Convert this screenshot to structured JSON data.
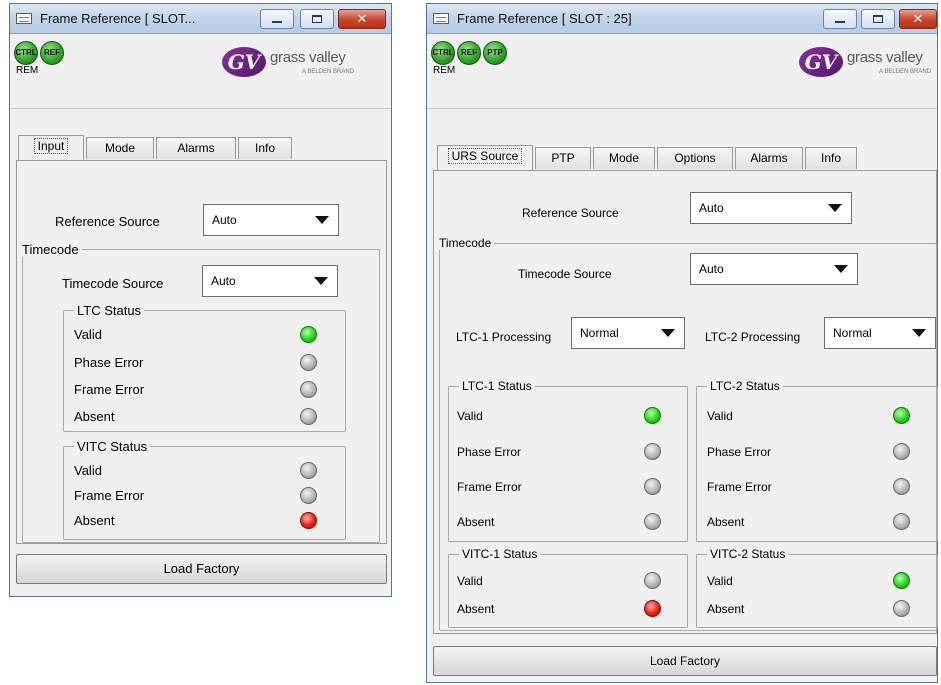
{
  "left_window": {
    "title": "Frame Reference [ SLOT...",
    "badges": [
      "CTRL",
      "REF"
    ],
    "rem_label": "REM",
    "logo": {
      "name": "grass valley",
      "sub": "A BELDEN BRAND"
    },
    "tabs": [
      "Input",
      "Mode",
      "Alarms",
      "Info"
    ],
    "active_tab": "Input",
    "reference_source": {
      "label": "Reference Source",
      "value": "Auto"
    },
    "timecode": {
      "group_label": "Timecode",
      "source_label": "Timecode Source",
      "source_value": "Auto",
      "ltc_status": {
        "title": "LTC Status",
        "rows": [
          {
            "label": "Valid",
            "state": "green"
          },
          {
            "label": "Phase Error",
            "state": "grey"
          },
          {
            "label": "Frame Error",
            "state": "grey"
          },
          {
            "label": "Absent",
            "state": "grey"
          }
        ]
      },
      "vitc_status": {
        "title": "VITC Status",
        "rows": [
          {
            "label": "Valid",
            "state": "grey"
          },
          {
            "label": "Frame Error",
            "state": "grey"
          },
          {
            "label": "Absent",
            "state": "red"
          }
        ]
      }
    },
    "load_factory": "Load Factory"
  },
  "right_window": {
    "title": "Frame Reference [ SLOT : 25]",
    "badges": [
      "CTRL",
      "REF",
      "PTP"
    ],
    "rem_label": "REM",
    "logo": {
      "name": "grass valley",
      "sub": "A BELDEN BRAND"
    },
    "tabs": [
      "URS Source",
      "PTP",
      "Mode",
      "Options",
      "Alarms",
      "Info"
    ],
    "active_tab": "URS Source",
    "reference_source": {
      "label": "Reference Source",
      "value": "Auto"
    },
    "timecode": {
      "group_label": "Timecode",
      "source_label": "Timecode Source",
      "source_value": "Auto",
      "ltc1_processing": {
        "label": "LTC-1 Processing",
        "value": "Normal"
      },
      "ltc2_processing": {
        "label": "LTC-2 Processing",
        "value": "Normal"
      },
      "ltc1_status": {
        "title": "LTC-1 Status",
        "rows": [
          {
            "label": "Valid",
            "state": "green"
          },
          {
            "label": "Phase Error",
            "state": "grey"
          },
          {
            "label": "Frame Error",
            "state": "grey"
          },
          {
            "label": "Absent",
            "state": "grey"
          }
        ]
      },
      "ltc2_status": {
        "title": "LTC-2 Status",
        "rows": [
          {
            "label": "Valid",
            "state": "green"
          },
          {
            "label": "Phase Error",
            "state": "grey"
          },
          {
            "label": "Frame Error",
            "state": "grey"
          },
          {
            "label": "Absent",
            "state": "grey"
          }
        ]
      },
      "vitc1_status": {
        "title": "VITC-1 Status",
        "rows": [
          {
            "label": "Valid",
            "state": "grey"
          },
          {
            "label": "Absent",
            "state": "red"
          }
        ]
      },
      "vitc2_status": {
        "title": "VITC-2 Status",
        "rows": [
          {
            "label": "Valid",
            "state": "green"
          },
          {
            "label": "Absent",
            "state": "grey"
          }
        ]
      }
    },
    "load_factory": "Load Factory"
  }
}
